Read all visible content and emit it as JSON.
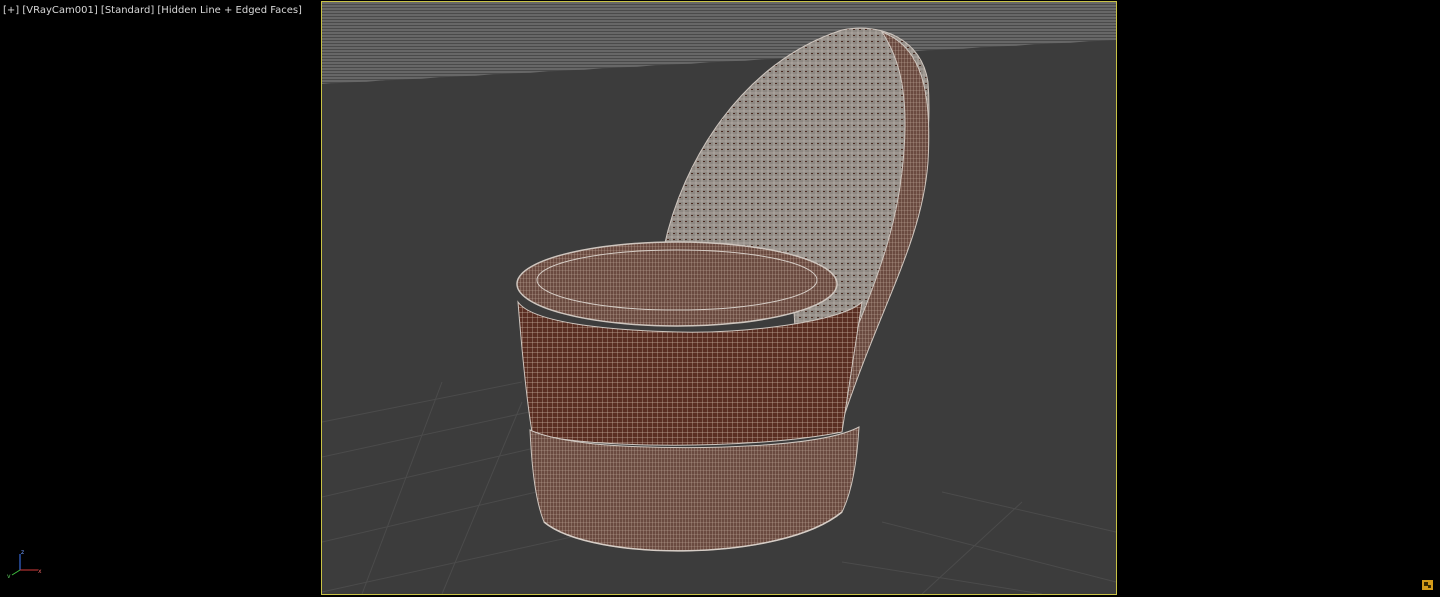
{
  "viewport": {
    "labels": {
      "plus": "[+]",
      "camera": "[VRayCam001]",
      "shading_mode": "[Standard]",
      "display_mode": "[Hidden Line + Edged Faces]"
    },
    "gizmo": {
      "x": "x",
      "y": "y",
      "z": "z"
    },
    "colors": {
      "background": "#000000",
      "scene_bg": "#3c3c3c",
      "safe_frame": "#c9c246",
      "wire": "#c8b4a4",
      "fabric": "#5a2e22"
    },
    "icons": [
      "axis-tripod-icon",
      "maximize-icon"
    ]
  }
}
